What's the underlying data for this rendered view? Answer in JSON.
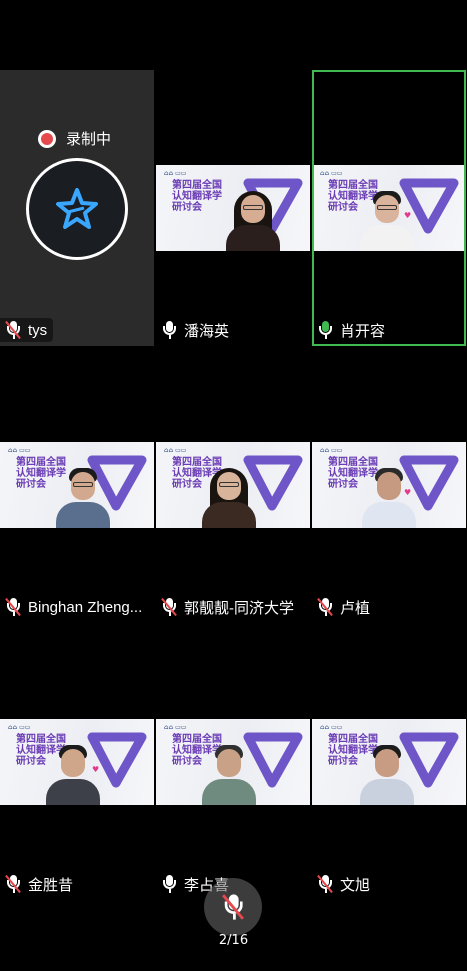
{
  "self": {
    "recording_label": "录制中",
    "name": "tys",
    "mic_muted": true
  },
  "participants": [
    {
      "name": "潘海英",
      "mic_muted": false,
      "active": false
    },
    {
      "name": "肖开容",
      "mic_muted": false,
      "active": true
    },
    {
      "name": "Binghan Zheng...",
      "mic_muted": true,
      "active": false
    },
    {
      "name": "郭靓靓-同济大学",
      "mic_muted": true,
      "active": false
    },
    {
      "name": "卢植",
      "mic_muted": true,
      "active": false
    },
    {
      "name": "金胜昔",
      "mic_muted": true,
      "active": false
    },
    {
      "name": "李占喜",
      "mic_muted": false,
      "active": false
    },
    {
      "name": "文旭",
      "mic_muted": true,
      "active": false
    }
  ],
  "background_slide": {
    "line1": "第四届全国",
    "line2": "认知翻译学",
    "line3": "研讨会"
  },
  "pagination": {
    "label": "2/16"
  },
  "colors": {
    "active_border": "#3fb950",
    "recording_dot": "#e5484d",
    "muted_slash": "#e5484d"
  }
}
